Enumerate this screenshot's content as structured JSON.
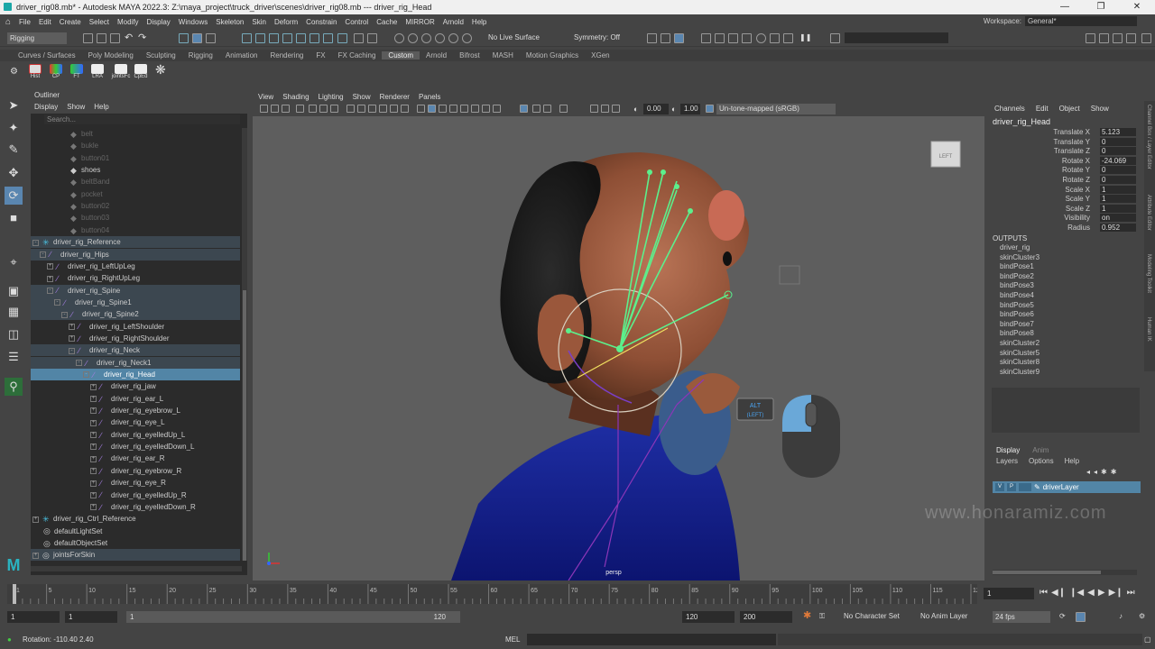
{
  "title": "driver_rig08.mb* - Autodesk MAYA 2022.3: Z:\\maya_project\\truck_driver\\scenes\\driver_rig08.mb  ---  driver_rig_Head",
  "menu": [
    "File",
    "Edit",
    "Create",
    "Select",
    "Modify",
    "Display",
    "Windows",
    "Skeleton",
    "Skin",
    "Deform",
    "Constrain",
    "Control",
    "Cache",
    "MIRROR",
    "Arnold",
    "Help"
  ],
  "workspace": {
    "label": "Workspace:",
    "value": "General*"
  },
  "status": {
    "menuset": "Rigging",
    "live_surface": "No Live Surface",
    "symmetry": "Symmetry: Off"
  },
  "shelf_tabs": [
    "Curves / Surfaces",
    "Poly Modeling",
    "Sculpting",
    "Rigging",
    "Animation",
    "Rendering",
    "FX",
    "FX Caching",
    "Custom",
    "Arnold",
    "Bifrost",
    "MASH",
    "Motion Graphics",
    "XGen"
  ],
  "shelf_active": "Custom",
  "shelf_icons": [
    "Hist",
    "CP",
    "FT",
    "LRA",
    "jointsFc",
    "CpEd"
  ],
  "outliner": {
    "title": "Outliner",
    "menu": [
      "Display",
      "Show",
      "Help"
    ],
    "search_placeholder": "Search...",
    "rows": [
      {
        "label": "belt",
        "dim": true
      },
      {
        "label": "bukle",
        "dim": true
      },
      {
        "label": "button01",
        "dim": true
      },
      {
        "label": "shoes",
        "dim": false
      },
      {
        "label": "beltBand",
        "dim": true
      },
      {
        "label": "pocket",
        "dim": true
      },
      {
        "label": "button02",
        "dim": true
      },
      {
        "label": "button03",
        "dim": true
      },
      {
        "label": "button04",
        "dim": true
      },
      {
        "label": "driver_rig_Reference"
      },
      {
        "label": "driver_rig_Hips"
      },
      {
        "label": "driver_rig_LeftUpLeg"
      },
      {
        "label": "driver_rig_RightUpLeg"
      },
      {
        "label": "driver_rig_Spine"
      },
      {
        "label": "driver_rig_Spine1"
      },
      {
        "label": "driver_rig_Spine2"
      },
      {
        "label": "driver_rig_LeftShoulder"
      },
      {
        "label": "driver_rig_RightShoulder"
      },
      {
        "label": "driver_rig_Neck"
      },
      {
        "label": "driver_rig_Neck1"
      },
      {
        "label": "driver_rig_Head"
      },
      {
        "label": "driver_rig_jaw"
      },
      {
        "label": "driver_rig_ear_L"
      },
      {
        "label": "driver_rig_eyebrow_L"
      },
      {
        "label": "driver_rig_eye_L"
      },
      {
        "label": "driver_rig_eyelledUp_L"
      },
      {
        "label": "driver_rig_eyelledDown_L"
      },
      {
        "label": "driver_rig_ear_R"
      },
      {
        "label": "driver_rig_eyebrow_R"
      },
      {
        "label": "driver_rig_eye_R"
      },
      {
        "label": "driver_rig_eyelledUp_R"
      },
      {
        "label": "driver_rig_eyelledDown_R"
      },
      {
        "label": "driver_rig_Ctrl_Reference"
      },
      {
        "label": "defaultLightSet"
      },
      {
        "label": "defaultObjectSet"
      },
      {
        "label": "jointsForSkin"
      }
    ]
  },
  "viewport": {
    "menu": [
      "View",
      "Shading",
      "Lighting",
      "Show",
      "Renderer",
      "Panels"
    ],
    "exposure": "0.00",
    "gamma": "1.00",
    "colorspace": "Un-tone-mapped (sRGB)",
    "camera": "persp",
    "viewcube": "LEFT",
    "key_hint": "ALT",
    "key_hint_sub": "(LEFT)"
  },
  "channelbox": {
    "menu": [
      "Channels",
      "Edit",
      "Object",
      "Show"
    ],
    "node": "driver_rig_Head",
    "attrs": [
      {
        "label": "Translate X",
        "value": "5.123"
      },
      {
        "label": "Translate Y",
        "value": "0"
      },
      {
        "label": "Translate Z",
        "value": "0"
      },
      {
        "label": "Rotate X",
        "value": "-24.069"
      },
      {
        "label": "Rotate Y",
        "value": "0"
      },
      {
        "label": "Rotate Z",
        "value": "0"
      },
      {
        "label": "Scale X",
        "value": "1"
      },
      {
        "label": "Scale Y",
        "value": "1"
      },
      {
        "label": "Scale Z",
        "value": "1"
      },
      {
        "label": "Visibility",
        "value": "on"
      },
      {
        "label": "Radius",
        "value": "0.952"
      }
    ],
    "outputs_label": "OUTPUTS",
    "outputs": [
      "driver_rig",
      "skinCluster3",
      "bindPose1",
      "bindPose2",
      "bindPose3",
      "bindPose4",
      "bindPose5",
      "bindPose6",
      "bindPose7",
      "bindPose8",
      "skinCluster2",
      "skinCluster5",
      "skinCluster8",
      "skinCluster9"
    ]
  },
  "layers": {
    "tabs": [
      "Display",
      "Anim"
    ],
    "menu": [
      "Layers",
      "Options",
      "Help"
    ],
    "layer": {
      "v": "V",
      "p": "P",
      "name": "driverLayer"
    }
  },
  "sidetabs": [
    "Channel Box / Layer Editor",
    "Attribute Editor",
    "Modeling Toolkit",
    "Human IK"
  ],
  "timeline": {
    "ticks": [
      "1",
      "5",
      "10",
      "15",
      "20",
      "25",
      "30",
      "35",
      "40",
      "45",
      "50",
      "55",
      "60",
      "65",
      "70",
      "75",
      "80",
      "85",
      "90",
      "95",
      "100",
      "105",
      "110",
      "115",
      "120"
    ],
    "current_frame": "1"
  },
  "range": {
    "start": "1",
    "anim_start": "1",
    "slider_start": "1",
    "slider_end": "120",
    "end": "120",
    "anim_end": "200",
    "character_set": "No Character Set",
    "anim_layer": "No Anim Layer",
    "fps": "24 fps"
  },
  "cmd": {
    "info": "Rotation:  -110.40       2.40",
    "mode": "MEL"
  },
  "watermark": "www.honaramiz.com",
  "colors": {
    "select": "#5285a6",
    "joint": "#5cf08c",
    "bg": "#444444"
  }
}
